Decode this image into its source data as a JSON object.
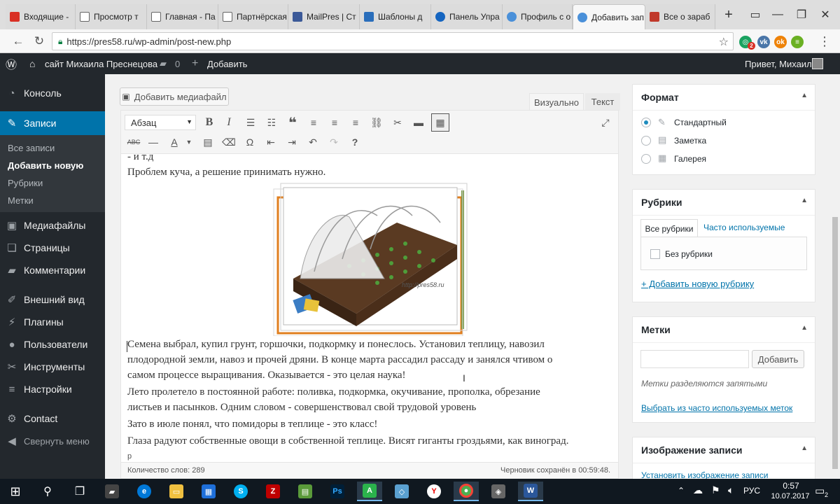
{
  "browser": {
    "tabs": [
      {
        "label": "Входящие -",
        "color": "#d93025"
      },
      {
        "label": "Просмотр т",
        "color": "#666666"
      },
      {
        "label": "Главная - Па",
        "color": "#666666"
      },
      {
        "label": "Партнёрская",
        "color": "#666666"
      },
      {
        "label": "MailPres | Ст",
        "color": "#3b5998"
      },
      {
        "label": "Шаблоны д",
        "color": "#2a6ebb"
      },
      {
        "label": "Панель Упра",
        "color": "#1565c0"
      },
      {
        "label": "Профиль с о",
        "color": "#4a90d9"
      },
      {
        "label": "Добавить зап",
        "color": "#4a90d9"
      },
      {
        "label": "Все о зараб",
        "color": "#c0392b"
      }
    ],
    "new_tab": "+",
    "url": "https://pres58.ru/wp-admin/post-new.php",
    "ext_badge": "2"
  },
  "adminbar": {
    "site_name": "сайт Михаила Преснецова",
    "comments": "0",
    "add": "Добавить",
    "greeting": "Привет, Михаил"
  },
  "sidebar": {
    "console": "Консоль",
    "posts": "Записи",
    "sub": [
      "Все записи",
      "Добавить новую",
      "Рубрики",
      "Метки"
    ],
    "items": [
      "Медиафайлы",
      "Страницы",
      "Комментарии",
      "Внешний вид",
      "Плагины",
      "Пользователи",
      "Инструменты",
      "Настройки",
      "Contact",
      "Свернуть меню"
    ]
  },
  "editor": {
    "add_media": "Добавить медиафайл",
    "tab_visual": "Визуально",
    "tab_text": "Текст",
    "format": "Абзац",
    "lines": [
      "- и т.д",
      "Проблем куча, а решение принимать нужно.",
      "Семена выбрал, купил грунт, горшочки, подкормку и понеслось. Установил теплицу, навозил",
      "плодородной земли, навоз и прочей дряни. В конце марта рассадил рассаду и занялся чтивом о",
      "самом процессе выращивания. Оказывается - это целая наука!",
      "Лето пролетело в постоянной работе: поливка, подкормка, окучивание, прополка, обрезание",
      "листьев и пасынков. Одним словом - совершенствовал свой трудовой уровень",
      "Зато в июле понял, что помидоры в теплице - это класс!",
      "Глаза радуют собственные овощи в собственной теплице. Висят гиганты гроздьями, как виноград."
    ],
    "image_watermark": "http://pres58.ru",
    "path": "p",
    "word_count": "Количество слов: 289",
    "saved": "Черновик сохранён в 00:59:48."
  },
  "format_box": {
    "title": "Формат",
    "options": [
      "Стандартный",
      "Заметка",
      "Галерея"
    ]
  },
  "categories_box": {
    "title": "Рубрики",
    "tab_all": "Все рубрики",
    "tab_popular": "Часто используемые",
    "item": "Без рубрики",
    "add_link": "+ Добавить новую рубрику"
  },
  "tags_box": {
    "title": "Метки",
    "add_button": "Добавить",
    "hint": "Метки разделяются запятыми",
    "choose_link": "Выбрать из часто используемых меток"
  },
  "featured_box": {
    "title": "Изображение записи",
    "set_link": "Установить изображение записи"
  },
  "taskbar": {
    "lang": "РУС",
    "time": "0:57",
    "date": "10.07.2017",
    "notif": "2"
  }
}
